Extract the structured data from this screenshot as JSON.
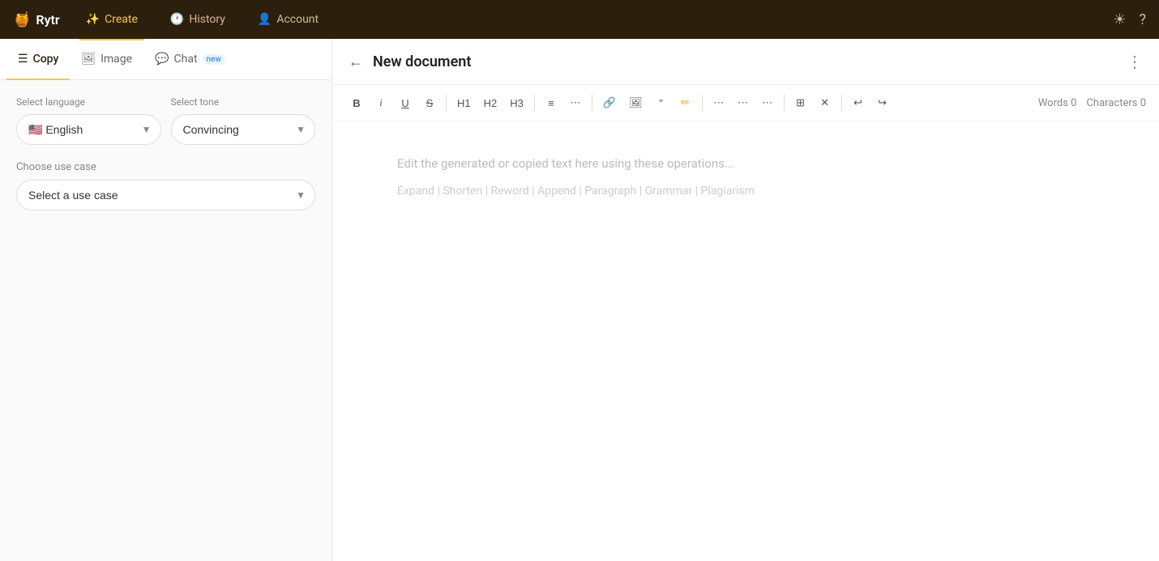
{
  "nav": {
    "logo_icon": "🍯",
    "logo_text": "Rytr",
    "items": [
      {
        "id": "create",
        "label": "Create",
        "icon": "✨",
        "active": true
      },
      {
        "id": "history",
        "label": "History",
        "icon": "🕐",
        "active": false
      },
      {
        "id": "account",
        "label": "Account",
        "icon": "👤",
        "active": false
      }
    ],
    "right_icons": [
      "☀",
      "?"
    ]
  },
  "sidebar": {
    "tabs": [
      {
        "id": "copy",
        "label": "Copy",
        "icon": "☰",
        "active": true
      },
      {
        "id": "image",
        "label": "Image",
        "icon": "🖼",
        "active": false
      },
      {
        "id": "chat",
        "label": "Chat",
        "icon": "💬",
        "active": false,
        "badge": "new"
      }
    ],
    "language_label": "Select language",
    "language_value": "🇺🇸 English",
    "tone_label": "Select tone",
    "tone_value": "Convincing",
    "use_case_label": "Choose use case",
    "use_case_placeholder": "Select a use case"
  },
  "editor": {
    "back_label": "←",
    "title": "New document",
    "more_icon": "⋮",
    "toolbar": {
      "bold": "B",
      "italic": "i",
      "underline": "U",
      "strike": "S",
      "h1": "H1",
      "h2": "H2",
      "h3": "H3",
      "bullet_list": "☰",
      "ordered_list": "☰",
      "link": "🔗",
      "image": "🖼",
      "quote": "❝",
      "highlight": "✏",
      "align_left": "≡",
      "align_center": "≡",
      "align_right": "≡",
      "table": "⊞",
      "clear": "✕",
      "undo": "↩",
      "redo": "↪"
    },
    "words_label": "Words",
    "words_count": "0",
    "characters_label": "Characters",
    "characters_count": "0",
    "placeholder": "Edit the generated or copied text here using these operations...",
    "operations": "Expand | Shorten | Reword | Append | Paragraph | Grammar | Plagiarism"
  }
}
